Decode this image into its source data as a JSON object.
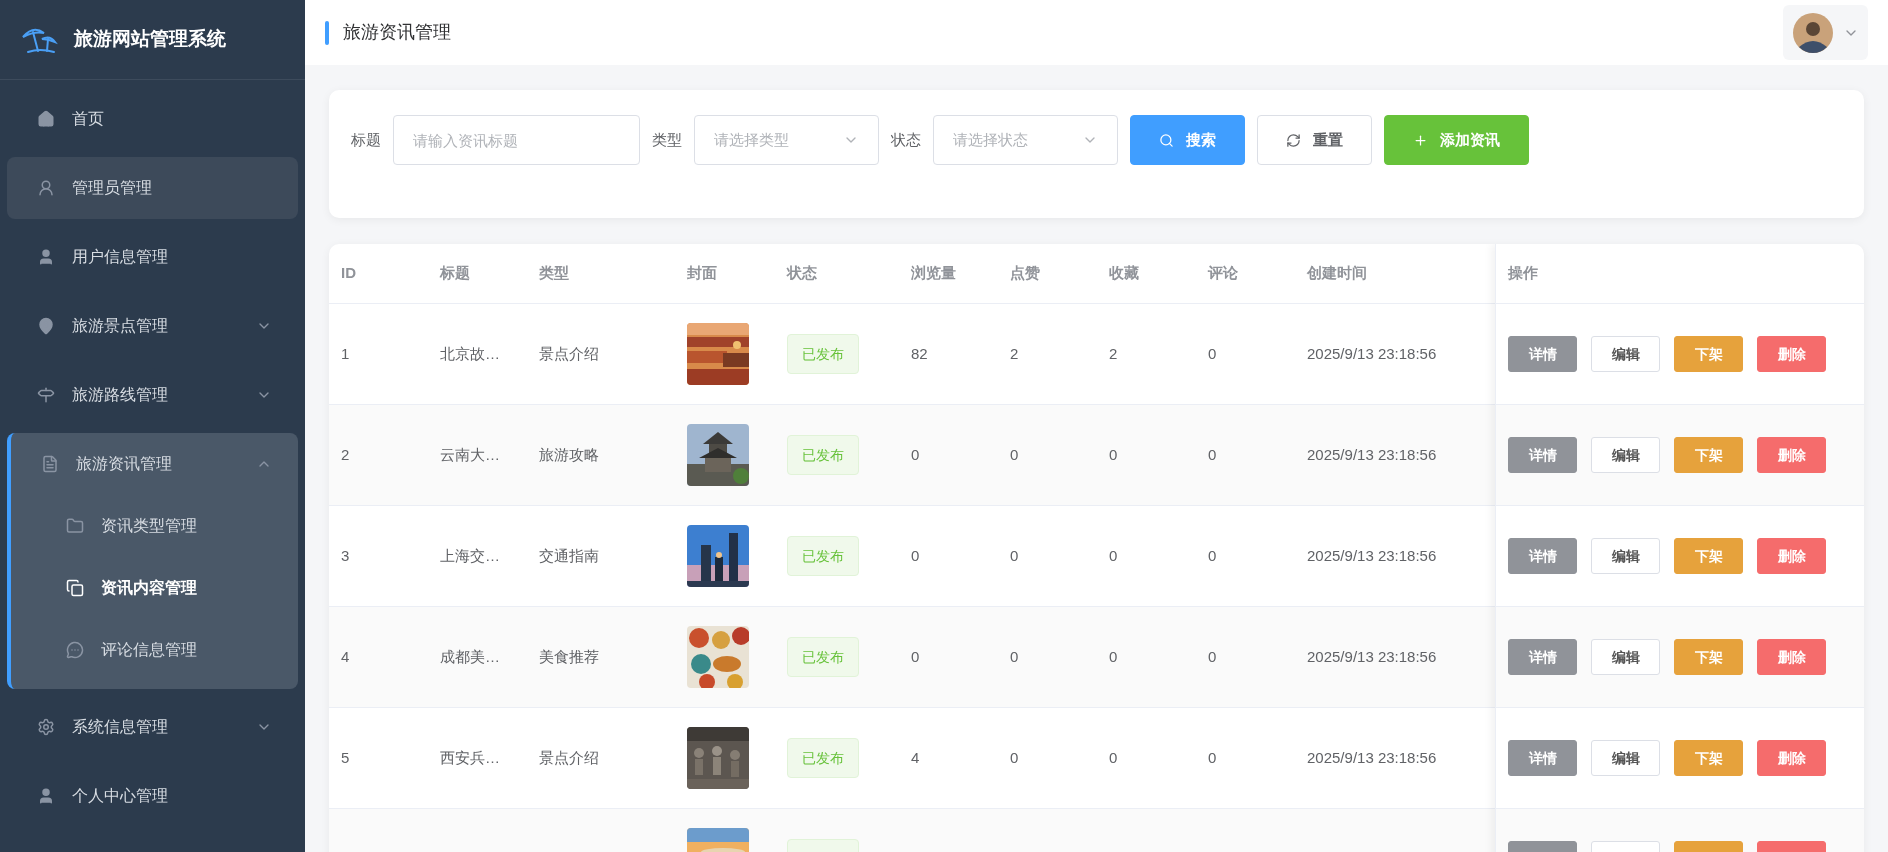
{
  "sidebar": {
    "title": "旅游网站管理系统",
    "items": [
      {
        "label": "首页",
        "highlighted": false,
        "expandable": false
      },
      {
        "label": "管理员管理",
        "highlighted": true,
        "expandable": false
      },
      {
        "label": "用户信息管理",
        "highlighted": false,
        "expandable": false
      },
      {
        "label": "旅游景点管理",
        "highlighted": false,
        "expandable": true,
        "expanded": false
      },
      {
        "label": "旅游路线管理",
        "highlighted": false,
        "expandable": true,
        "expanded": false
      },
      {
        "label": "旅游资讯管理",
        "highlighted": false,
        "expandable": true,
        "expanded": true,
        "children": [
          {
            "label": "资讯类型管理",
            "selected": false
          },
          {
            "label": "资讯内容管理",
            "selected": true
          },
          {
            "label": "评论信息管理",
            "selected": false
          }
        ]
      },
      {
        "label": "系统信息管理",
        "highlighted": false,
        "expandable": true,
        "expanded": false
      },
      {
        "label": "个人中心管理",
        "highlighted": false,
        "expandable": false
      }
    ]
  },
  "header": {
    "title": "旅游资讯管理"
  },
  "filters": {
    "fields": [
      {
        "label": "标题",
        "kind": "input",
        "placeholder": "请输入资讯标题"
      },
      {
        "label": "类型",
        "kind": "select",
        "placeholder": "请选择类型"
      },
      {
        "label": "状态",
        "kind": "select",
        "placeholder": "请选择状态"
      }
    ],
    "buttons": [
      {
        "label": "搜索",
        "kind": "primary"
      },
      {
        "label": "重置",
        "kind": "plain"
      },
      {
        "label": "添加资讯",
        "kind": "success"
      }
    ]
  },
  "table": {
    "columns": [
      "ID",
      "标题",
      "类型",
      "封面",
      "状态",
      "浏览量",
      "点赞",
      "收藏",
      "评论",
      "创建时间",
      "操作"
    ],
    "rows": [
      {
        "id": "1",
        "title": "北京故…",
        "type": "景点介绍",
        "status": {
          "label": "已发布",
          "kind": "success"
        },
        "views": "82",
        "likes": "2",
        "favorites": "2",
        "comments": "0",
        "created": "2025/9/13 23:18:56",
        "actions": [
          {
            "label": "详情",
            "kind": "info"
          },
          {
            "label": "编辑",
            "kind": "plain"
          },
          {
            "label": "下架",
            "kind": "warning"
          },
          {
            "label": "删除",
            "kind": "danger"
          }
        ]
      },
      {
        "id": "2",
        "title": "云南大…",
        "type": "旅游攻略",
        "status": {
          "label": "已发布",
          "kind": "success"
        },
        "views": "0",
        "likes": "0",
        "favorites": "0",
        "comments": "0",
        "created": "2025/9/13 23:18:56",
        "actions": [
          {
            "label": "详情",
            "kind": "info"
          },
          {
            "label": "编辑",
            "kind": "plain"
          },
          {
            "label": "下架",
            "kind": "warning"
          },
          {
            "label": "删除",
            "kind": "danger"
          }
        ]
      },
      {
        "id": "3",
        "title": "上海交…",
        "type": "交通指南",
        "status": {
          "label": "已发布",
          "kind": "success"
        },
        "views": "0",
        "likes": "0",
        "favorites": "0",
        "comments": "0",
        "created": "2025/9/13 23:18:56",
        "actions": [
          {
            "label": "详情",
            "kind": "info"
          },
          {
            "label": "编辑",
            "kind": "plain"
          },
          {
            "label": "下架",
            "kind": "warning"
          },
          {
            "label": "删除",
            "kind": "danger"
          }
        ]
      },
      {
        "id": "4",
        "title": "成都美…",
        "type": "美食推荐",
        "status": {
          "label": "已发布",
          "kind": "success"
        },
        "views": "0",
        "likes": "0",
        "favorites": "0",
        "comments": "0",
        "created": "2025/9/13 23:18:56",
        "actions": [
          {
            "label": "详情",
            "kind": "info"
          },
          {
            "label": "编辑",
            "kind": "plain"
          },
          {
            "label": "下架",
            "kind": "warning"
          },
          {
            "label": "删除",
            "kind": "danger"
          }
        ]
      },
      {
        "id": "5",
        "title": "西安兵…",
        "type": "景点介绍",
        "status": {
          "label": "已发布",
          "kind": "success"
        },
        "views": "4",
        "likes": "0",
        "favorites": "0",
        "comments": "0",
        "created": "2025/9/13 23:18:56",
        "actions": [
          {
            "label": "详情",
            "kind": "info"
          },
          {
            "label": "编辑",
            "kind": "plain"
          },
          {
            "label": "下架",
            "kind": "warning"
          },
          {
            "label": "删除",
            "kind": "danger"
          }
        ]
      },
      {
        "status": {
          "kind": "success"
        },
        "actions": [
          {
            "kind": "info"
          },
          {
            "kind": "plain"
          },
          {
            "kind": "warning"
          },
          {
            "kind": "danger"
          }
        ]
      }
    ]
  }
}
